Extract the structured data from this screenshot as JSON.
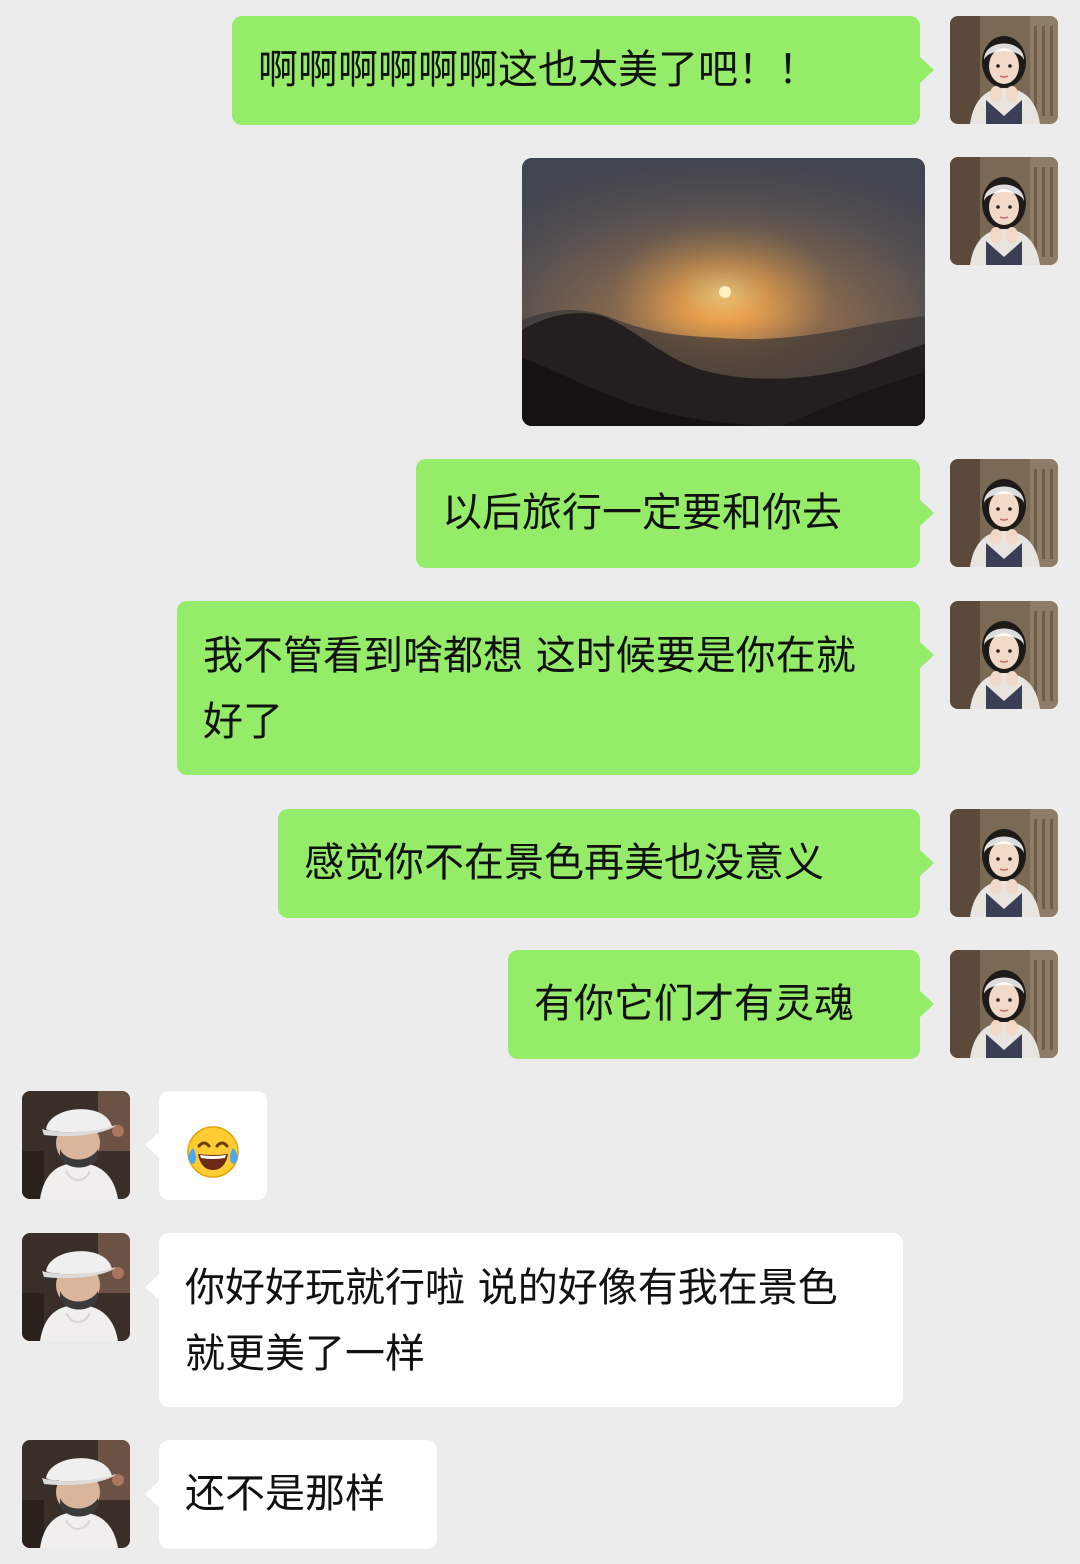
{
  "messages": [
    {
      "text": "啊啊啊啊啊啊这也太美了吧！！"
    },
    {
      "image": "sunset-over-mountains-photo"
    },
    {
      "text": "以后旅行一定要和你去"
    },
    {
      "text": "我不管看到啥都想 这时候要是你在就好了"
    },
    {
      "text": "感觉你不在景色再美也没意义"
    },
    {
      "text": "有你它们才有灵魂"
    },
    {
      "emoji": "face-with-tears-of-joy-emoji"
    },
    {
      "text": "你好好玩就行啦  说的好像有我在景色就更美了一样"
    },
    {
      "text": "还不是那样"
    }
  ],
  "colors": {
    "background": "#ececec",
    "outgoing_bubble": "#95ec69",
    "incoming_bubble": "#ffffff",
    "text": "#111111"
  }
}
